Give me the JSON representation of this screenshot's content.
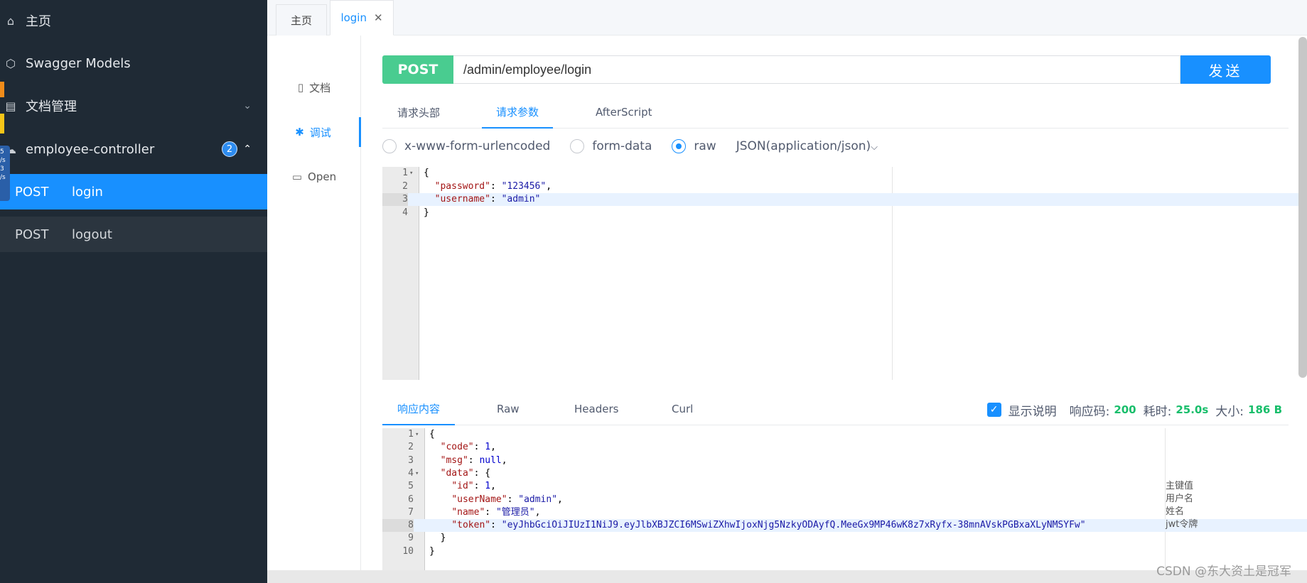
{
  "sidebar": {
    "home_label": "主页",
    "models_label": "Swagger Models",
    "docs_label": "文档管理",
    "controller_label": "employee-controller",
    "controller_badge": "2",
    "apis": [
      {
        "method": "POST",
        "name": "login"
      },
      {
        "method": "POST",
        "name": "logout"
      }
    ],
    "overlay_text": "5 /s 3 /s"
  },
  "tabs": {
    "home": "主页",
    "login": "login"
  },
  "rail": {
    "doc": "文档",
    "debug": "调试",
    "open": "Open"
  },
  "request": {
    "method": "POST",
    "url": "/admin/employee/login",
    "send_label": "发送",
    "tabs": [
      "请求头部",
      "请求参数",
      "AfterScript"
    ],
    "active_tab": "请求参数",
    "body_types": [
      "x-www-form-urlencoded",
      "form-data",
      "raw"
    ],
    "selected_type": "raw",
    "content_type": "JSON(application/json)",
    "body_lines": [
      "{",
      "  \"password\": \"123456\",",
      "  \"username\": \"admin\"",
      "}"
    ]
  },
  "response": {
    "tabs": [
      "响应内容",
      "Raw",
      "Headers",
      "Curl"
    ],
    "active_tab": "响应内容",
    "show_desc_label": "显示说明",
    "show_desc_checked": true,
    "code_label": "响应码:",
    "code_value": "200",
    "time_label": "耗时:",
    "time_value": "25.0s",
    "size_label": "大小:",
    "size_value": "186 B",
    "body_lines": [
      "{",
      "  \"code\": 1,",
      "  \"msg\": null,",
      "  \"data\": {",
      "    \"id\": 1,",
      "    \"userName\": \"admin\",",
      "    \"name\": \"管理员\",",
      "    \"token\": \"eyJhbGciOiJIUzI1NiJ9.eyJlbXBJZCI6MSwiZXhwIjoxNjg5NzkyODAyfQ.MeeGx9MP46wK8z7xRyfx-38mnAVskPGBxaXLyNMSYFw\"",
      "  }",
      "}"
    ],
    "annotations": [
      "主键值",
      "用户名",
      "姓名",
      "jwt令牌"
    ]
  },
  "watermark": "CSDN @东大资土是冠军",
  "colors": {
    "sidebar_bg": "#1f2a35",
    "accent": "#1890ff",
    "post_green": "#49cc90",
    "success": "#19be6b"
  }
}
